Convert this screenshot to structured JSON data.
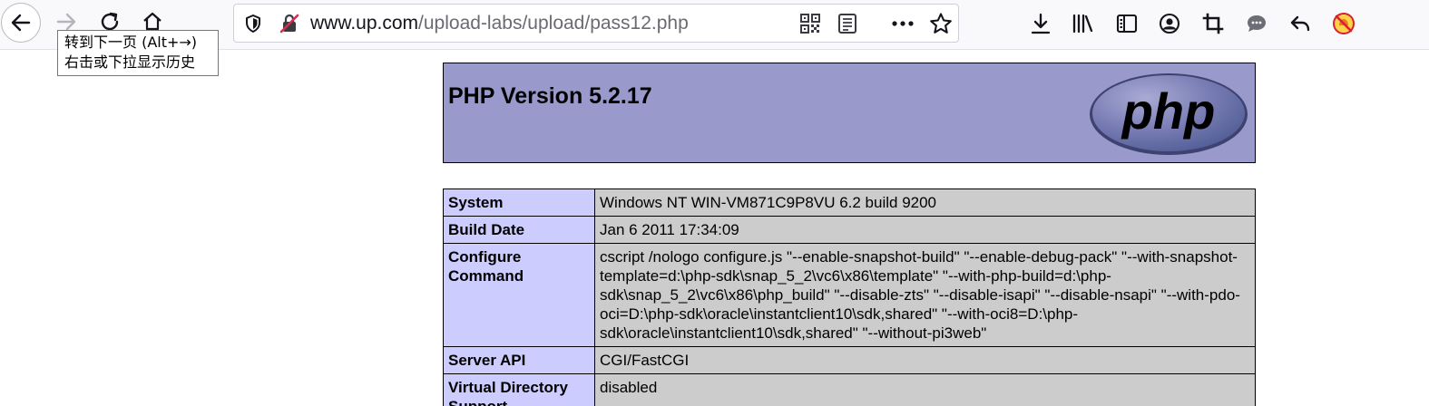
{
  "browser": {
    "url": {
      "host": "www.up.com",
      "path": "/upload-labs/upload/pass12.php"
    },
    "tooltip": {
      "line1": "转到下一页 (Alt+→)",
      "line2": "右击或下拉显示历史"
    },
    "icons": {
      "back": "arrow-left-icon",
      "forward": "arrow-right-icon",
      "reload": "reload-icon",
      "home": "home-icon",
      "tracking": "shield-icon",
      "insecure": "insecure-lock-icon",
      "qr": "qr-code-icon",
      "reader": "reader-view-icon",
      "more": "more-icon",
      "bookmark": "star-icon",
      "downloads": "download-icon",
      "library": "library-icon",
      "sidebar": "sidebar-icon",
      "account": "account-icon",
      "screenshot": "crop-icon",
      "chat": "chat-icon",
      "undo": "undo-icon",
      "addon": "addon-icon"
    }
  },
  "phpinfo": {
    "title": "PHP Version 5.2.17",
    "logo_text": "php",
    "header_color": "#9999cc",
    "rows": [
      {
        "label": "System",
        "value": "Windows NT WIN-VM871C9P8VU 6.2 build 9200"
      },
      {
        "label": "Build Date",
        "value": "Jan 6 2011 17:34:09"
      },
      {
        "label": "Configure Command",
        "value": "cscript /nologo configure.js \"--enable-snapshot-build\" \"--enable-debug-pack\" \"--with-snapshot-template=d:\\php-sdk\\snap_5_2\\vc6\\x86\\template\" \"--with-php-build=d:\\php-sdk\\snap_5_2\\vc6\\x86\\php_build\" \"--disable-zts\" \"--disable-isapi\" \"--disable-nsapi\" \"--with-pdo-oci=D:\\php-sdk\\oracle\\instantclient10\\sdk,shared\" \"--with-oci8=D:\\php-sdk\\oracle\\instantclient10\\sdk,shared\" \"--without-pi3web\""
      },
      {
        "label": "Server API",
        "value": "CGI/FastCGI"
      },
      {
        "label": "Virtual Directory Support",
        "value": "disabled"
      }
    ]
  }
}
